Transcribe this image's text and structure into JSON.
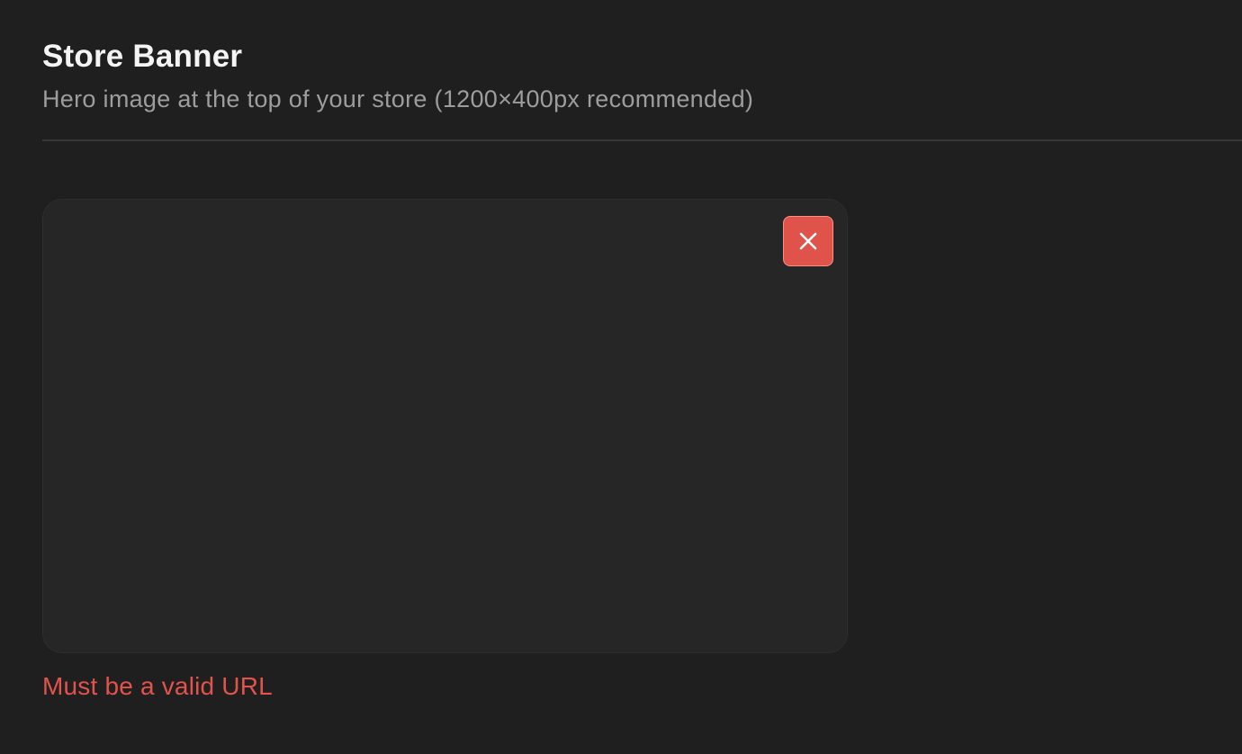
{
  "section": {
    "title": "Store Banner",
    "description": "Hero image at the top of your store (1200×400px recommended)"
  },
  "banner": {
    "remove_icon": "close-icon",
    "remove_button_color": "#e0534a"
  },
  "validation": {
    "error": "Must be a valid URL",
    "error_color": "#e3534b"
  }
}
